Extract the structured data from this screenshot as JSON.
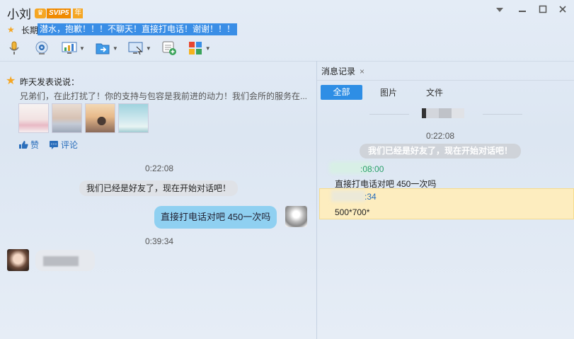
{
  "header": {
    "name": "小刘",
    "vip_level": "SVIP5",
    "vip_year": "年",
    "signature_label": "长期",
    "signature_text": "潜水，抱歉！！！不聊天！直接打电话！谢谢！！！"
  },
  "window_controls": [
    "chevron-down",
    "minimize",
    "maximize",
    "close"
  ],
  "toolbar": [
    {
      "icon": "microphone-icon",
      "dropdown": false
    },
    {
      "icon": "camera-icon",
      "dropdown": false
    },
    {
      "icon": "screen-share-icon",
      "dropdown": true
    },
    {
      "icon": "send-file-icon",
      "dropdown": true
    },
    {
      "icon": "remote-desktop-icon",
      "dropdown": true
    },
    {
      "icon": "new-chat-icon",
      "dropdown": false
    },
    {
      "icon": "apps-icon",
      "dropdown": true
    }
  ],
  "feed": {
    "title": "昨天发表说说：",
    "text": "兄弟们，在此打扰了！你的支持与包容是我前进的动力！我们会所的服务在...",
    "like_label": "赞",
    "comment_label": "评论"
  },
  "chat": {
    "time1": "0:22:08",
    "system_message": "我们已经是好友了，现在开始对话吧！",
    "sent_message": "直接打电话对吧 450一次吗",
    "time2": "0:39:34"
  },
  "history": {
    "tab_title": "消息记录",
    "close_glyph": "×",
    "filters": [
      "全部",
      "图片",
      "文件"
    ],
    "time1": "0:22:08",
    "system_message": "我们已经是好友了，现在开始对话吧！",
    "entry1_time_partial": ":08:00",
    "entry1_message": "直接打电话对吧 450一次吗",
    "entry2_time_partial": ":34",
    "entry2_message": "500*700*"
  },
  "colors": {
    "accent": "#2e8ee5",
    "sent_bubble": "#8fd0f1",
    "highlight": "#fdedbf",
    "vip": "#f5a623"
  }
}
